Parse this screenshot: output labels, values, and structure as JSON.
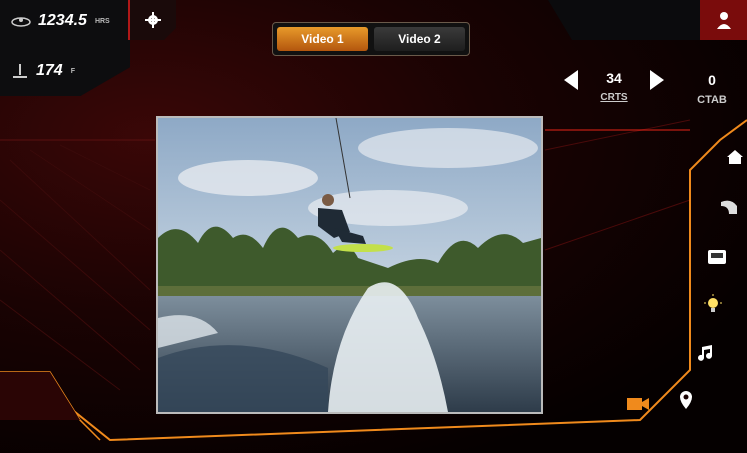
{
  "stats": {
    "hours_value": "1234.5",
    "hours_unit": "HRS",
    "depth_value": "174",
    "depth_unit": "F"
  },
  "video_tabs": [
    {
      "label": "Video 1",
      "active": true
    },
    {
      "label": "Video 2",
      "active": false
    }
  ],
  "tab_stepper": {
    "value": "34",
    "label": "CRTS"
  },
  "ctab": {
    "value": "0",
    "label": "CTAB"
  },
  "right_nav": {
    "items": [
      "home-icon",
      "wave-icon",
      "screen-icon",
      "lightbulb-icon",
      "music-icon",
      "camera-icon",
      "location-icon"
    ]
  },
  "colors": {
    "accent_orange": "#f08a1c",
    "accent_red": "#b01818",
    "panel_dark": "#0d0d0f"
  }
}
